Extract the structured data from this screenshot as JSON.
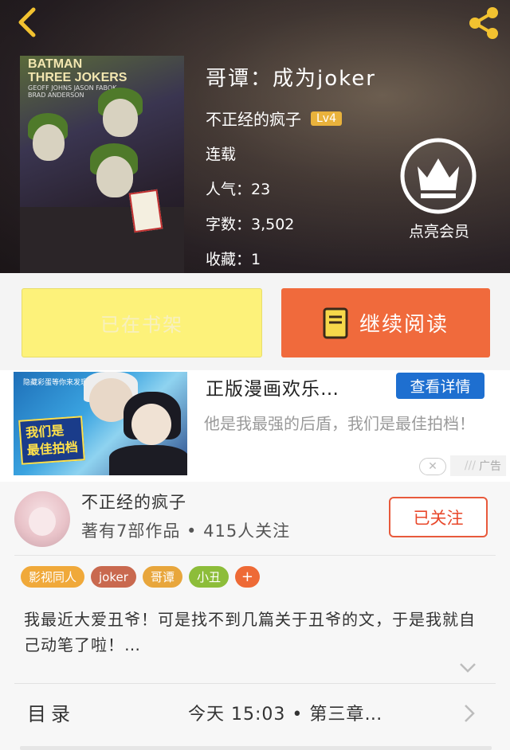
{
  "header": {
    "back_icon": "chevron-left-icon",
    "share_icon": "share-icon",
    "accent": "#f2c230"
  },
  "book": {
    "cover": {
      "title_line1": "BATMAN",
      "title_line2": "THREE JOKERS",
      "credits": "GEOFF JOHNS  JASON FABOK",
      "credits2": "BRAD ANDERSON"
    },
    "title": "哥谭：成为joker",
    "author": "不正经的疯子",
    "level": "Lv4",
    "status": "连载",
    "popularity": "人气：23",
    "word_count": "字数：3,502",
    "favorites": "收藏：1",
    "vip_label": "点亮会员"
  },
  "actions": {
    "shelf_label": "已在书架",
    "read_label": "继续阅读",
    "colors": {
      "shelf": "#fdf27a",
      "read": "#f06a3c"
    }
  },
  "ad": {
    "image_top": "隐藏彩蛋等你来发现！",
    "image_badge_line1": "我们是",
    "image_badge_line2": "最佳拍档",
    "title": "正版漫画欢乐…",
    "button": "查看详情",
    "description": "他是我最强的后盾，我们是最佳拍档！",
    "close_icon": "close-icon",
    "label": "广告"
  },
  "author_section": {
    "name": "不正经的疯子",
    "stats": "著有7部作品 • 415人关注",
    "follow_label": "已关注",
    "tags": [
      {
        "label": "影视同人",
        "color": "#f0a93a"
      },
      {
        "label": "joker",
        "color": "#c9694f"
      },
      {
        "label": "哥谭",
        "color": "#e8a63c"
      },
      {
        "label": "小丑",
        "color": "#8dbd3a"
      }
    ],
    "tag_more": "+",
    "description": "我最近大爱丑爷！可是找不到几篇关于丑爷的文，于是我就自己动笔了啦！…",
    "toc_label": "目录",
    "latest_update": "今天  15:03  •  第三章…"
  }
}
